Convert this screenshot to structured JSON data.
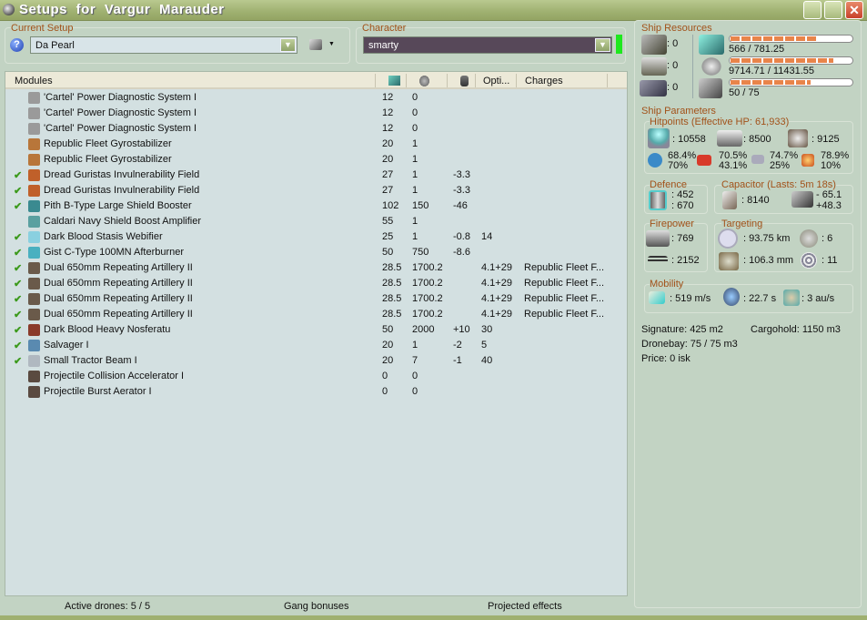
{
  "window": {
    "title": "Setups  for  Vargur  Marauder",
    "close": "✕"
  },
  "setup": {
    "label": "Current Setup",
    "value": "Da Pearl",
    "help": "?"
  },
  "character": {
    "label": "Character",
    "value": "smarty"
  },
  "modules": {
    "headers": {
      "name": "Modules",
      "opt": "Opti...",
      "charges": "Charges"
    },
    "rows": [
      {
        "active": false,
        "icon": "power-diagnostic-icon",
        "color": "#9a9a9a",
        "name": "'Cartel' Power Diagnostic System I",
        "cpu": "12",
        "pg": "0",
        "cap": "",
        "opt": "",
        "charge": ""
      },
      {
        "active": false,
        "icon": "power-diagnostic-icon",
        "color": "#9a9a9a",
        "name": "'Cartel' Power Diagnostic System I",
        "cpu": "12",
        "pg": "0",
        "cap": "",
        "opt": "",
        "charge": ""
      },
      {
        "active": false,
        "icon": "power-diagnostic-icon",
        "color": "#9a9a9a",
        "name": "'Cartel' Power Diagnostic System I",
        "cpu": "12",
        "pg": "0",
        "cap": "",
        "opt": "",
        "charge": ""
      },
      {
        "active": false,
        "icon": "gyrostabilizer-icon",
        "color": "#b8763a",
        "name": "Republic Fleet Gyrostabilizer",
        "cpu": "20",
        "pg": "1",
        "cap": "",
        "opt": "",
        "charge": ""
      },
      {
        "active": false,
        "icon": "gyrostabilizer-icon",
        "color": "#b8763a",
        "name": "Republic Fleet Gyrostabilizer",
        "cpu": "20",
        "pg": "1",
        "cap": "",
        "opt": "",
        "charge": ""
      },
      {
        "active": true,
        "icon": "invulnerability-field-icon",
        "color": "#c0602a",
        "name": "Dread Guristas Invulnerability Field",
        "cpu": "27",
        "pg": "1",
        "cap": "-3.3",
        "opt": "",
        "charge": ""
      },
      {
        "active": true,
        "icon": "invulnerability-field-icon",
        "color": "#c0602a",
        "name": "Dread Guristas Invulnerability Field",
        "cpu": "27",
        "pg": "1",
        "cap": "-3.3",
        "opt": "",
        "charge": ""
      },
      {
        "active": true,
        "icon": "shield-booster-icon",
        "color": "#3a8a90",
        "name": "Pith B-Type Large Shield Booster",
        "cpu": "102",
        "pg": "150",
        "cap": "-46",
        "opt": "",
        "charge": ""
      },
      {
        "active": false,
        "icon": "shield-amplifier-icon",
        "color": "#5aa0a0",
        "name": "Caldari Navy Shield Boost Amplifier",
        "cpu": "55",
        "pg": "1",
        "cap": "",
        "opt": "",
        "charge": ""
      },
      {
        "active": true,
        "icon": "stasis-webifier-icon",
        "color": "#8ad0e0",
        "name": "Dark Blood Stasis Webifier",
        "cpu": "25",
        "pg": "1",
        "cap": "-0.8",
        "opt": "14",
        "charge": ""
      },
      {
        "active": true,
        "icon": "afterburner-icon",
        "color": "#4ab0c0",
        "name": "Gist C-Type 100MN Afterburner",
        "cpu": "50",
        "pg": "750",
        "cap": "-8.6",
        "opt": "",
        "charge": ""
      },
      {
        "active": true,
        "icon": "artillery-icon",
        "color": "#6a5a4a",
        "name": "Dual 650mm Repeating Artillery II",
        "cpu": "28.5",
        "pg": "1700.2",
        "cap": "",
        "opt": "4.1+29",
        "charge": "Republic Fleet F..."
      },
      {
        "active": true,
        "icon": "artillery-icon",
        "color": "#6a5a4a",
        "name": "Dual 650mm Repeating Artillery II",
        "cpu": "28.5",
        "pg": "1700.2",
        "cap": "",
        "opt": "4.1+29",
        "charge": "Republic Fleet F..."
      },
      {
        "active": true,
        "icon": "artillery-icon",
        "color": "#6a5a4a",
        "name": "Dual 650mm Repeating Artillery II",
        "cpu": "28.5",
        "pg": "1700.2",
        "cap": "",
        "opt": "4.1+29",
        "charge": "Republic Fleet F..."
      },
      {
        "active": true,
        "icon": "artillery-icon",
        "color": "#6a5a4a",
        "name": "Dual 650mm Repeating Artillery II",
        "cpu": "28.5",
        "pg": "1700.2",
        "cap": "",
        "opt": "4.1+29",
        "charge": "Republic Fleet F..."
      },
      {
        "active": true,
        "icon": "nosferatu-icon",
        "color": "#8a3a2a",
        "name": "Dark Blood Heavy Nosferatu",
        "cpu": "50",
        "pg": "2000",
        "cap": "+10",
        "opt": "30",
        "charge": ""
      },
      {
        "active": true,
        "icon": "salvager-icon",
        "color": "#5a8ab0",
        "name": "Salvager I",
        "cpu": "20",
        "pg": "1",
        "cap": "-2",
        "opt": "5",
        "charge": ""
      },
      {
        "active": true,
        "icon": "tractor-beam-icon",
        "color": "#b0b8c0",
        "name": "Small Tractor Beam I",
        "cpu": "20",
        "pg": "7",
        "cap": "-1",
        "opt": "40",
        "charge": ""
      },
      {
        "active": false,
        "icon": "rig-icon",
        "color": "#5a4a40",
        "name": "Projectile Collision Accelerator I",
        "cpu": "0",
        "pg": "0",
        "cap": "",
        "opt": "",
        "charge": ""
      },
      {
        "active": false,
        "icon": "rig-icon",
        "color": "#5a4a40",
        "name": "Projectile Burst Aerator I",
        "cpu": "0",
        "pg": "0",
        "cap": "",
        "opt": "",
        "charge": ""
      }
    ]
  },
  "status": {
    "drones": "Active drones: 5 / 5",
    "gang": "Gang bonuses",
    "projected": "Projected effects"
  },
  "resources": {
    "label": "Ship Resources",
    "turrets": ": 0",
    "launchers": ": 0",
    "rigs": ": 0",
    "cpu": {
      "text": "566 / 781.25",
      "fraction": 0.72
    },
    "powergrid": {
      "text": "9714.71 / 11431.55",
      "fraction": 0.85
    },
    "calibration": {
      "text": "50 / 75",
      "fraction": 0.67
    }
  },
  "params": {
    "label": "Ship Parameters",
    "hp": {
      "label": "Hitpoints (Effective HP: 61,933)",
      "shield": ": 10558",
      "armor": ": 8500",
      "structure": ": 9125",
      "em": [
        "68.4%",
        "70%"
      ],
      "thermal": [
        "70.5%",
        "43.1%"
      ],
      "kinetic": [
        "74.7%",
        "25%"
      ],
      "explosive": [
        "78.9%",
        "10%"
      ]
    },
    "defence": {
      "label": "Defence",
      "a": ": 452",
      "b": ": 670"
    },
    "capacitor": {
      "label": "Capacitor (Lasts: 5m 18s)",
      "amount": ": 8140",
      "use": "- 65.1",
      "recharge": "+48.3"
    },
    "firepower": {
      "label": "Firepower",
      "dps": ": 769",
      "volley": ": 2152"
    },
    "targeting": {
      "label": "Targeting",
      "range": ": 93.75 km",
      "targets": ": 6",
      "resolution": ": 106.3 mm",
      "sensor": ": 11"
    },
    "mobility": {
      "label": "Mobility",
      "speed": ": 519 m/s",
      "align": ": 22.7 s",
      "warp": ": 3 au/s"
    },
    "signature": "Signature: 425 m2",
    "cargo": "Cargohold: 1150 m3",
    "dronebay": "Dronebay: 75 / 75 m3",
    "price": "Price: 0 isk"
  }
}
